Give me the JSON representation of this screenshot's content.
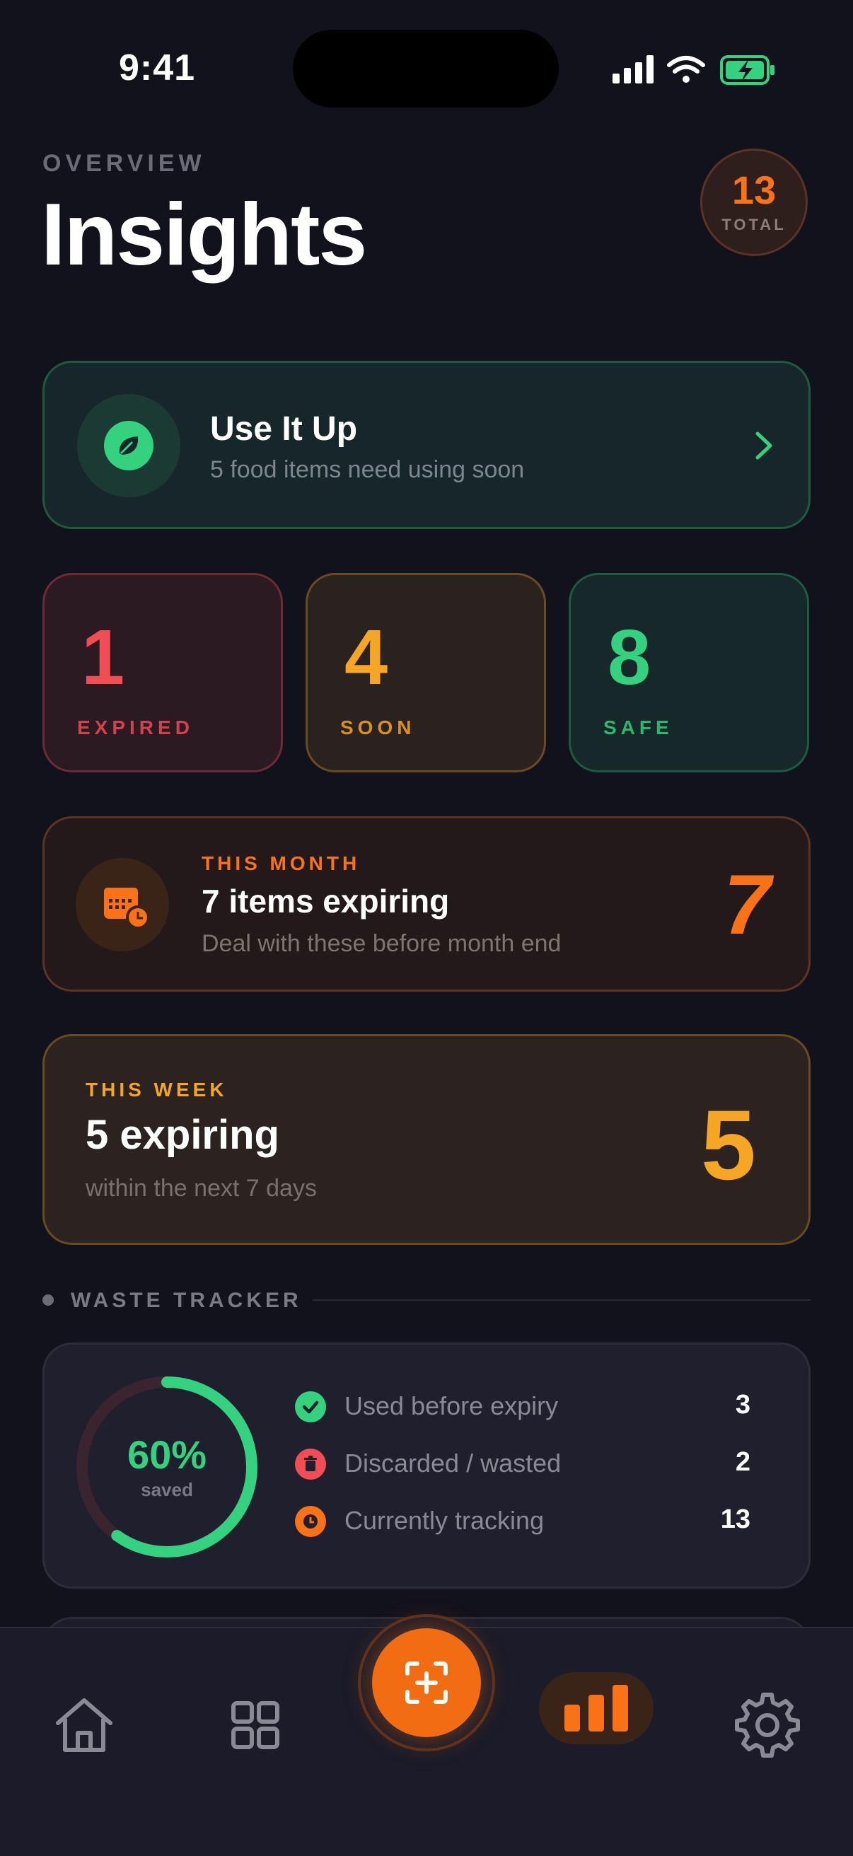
{
  "status_bar": {
    "time": "9:41"
  },
  "header": {
    "overline": "OVERVIEW",
    "title": "Insights",
    "total_count": "13",
    "total_label": "TOTAL"
  },
  "use_it_up": {
    "title": "Use It Up",
    "subtitle": "5 food items need using soon"
  },
  "stats": [
    {
      "value": "1",
      "label": "EXPIRED",
      "color": "#f04d55"
    },
    {
      "value": "4",
      "label": "SOON",
      "color": "#f5a623"
    },
    {
      "value": "8",
      "label": "SAFE",
      "color": "#34d27e"
    }
  ],
  "this_month": {
    "overline": "THIS MONTH",
    "title": "7 items expiring",
    "subtitle": "Deal with these before month end",
    "count": "7"
  },
  "this_week": {
    "overline": "THIS WEEK",
    "title": "5 expiring",
    "subtitle": "within the next 7 days",
    "count": "5"
  },
  "waste_tracker": {
    "section_label": "WASTE TRACKER",
    "saved_percent_text": "60%",
    "saved_fraction": 0.6,
    "saved_label": "saved",
    "rows": [
      {
        "icon": "check-icon",
        "label": "Used before expiry",
        "value": "3",
        "color": "#34d27e"
      },
      {
        "icon": "trash-icon",
        "label": "Discarded / wasted",
        "value": "2",
        "color": "#f04d55"
      },
      {
        "icon": "clock-icon",
        "label": "Currently tracking",
        "value": "13",
        "color": "#f97316"
      }
    ]
  },
  "tab_bar": {
    "items": [
      {
        "name": "home",
        "icon": "home-icon"
      },
      {
        "name": "grid",
        "icon": "grid-icon"
      },
      {
        "name": "scan",
        "icon": "scan-add-icon"
      },
      {
        "name": "insights",
        "icon": "bar-chart-icon",
        "active": true
      },
      {
        "name": "settings",
        "icon": "gear-icon"
      }
    ]
  },
  "colors": {
    "accent": "#f97316",
    "background": "#12121c",
    "green": "#34d27e",
    "red": "#f04d55",
    "amber": "#f5a623"
  }
}
